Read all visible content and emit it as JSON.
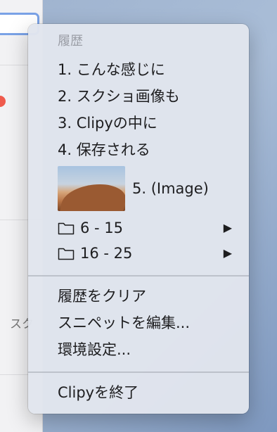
{
  "menu": {
    "header": "履歴",
    "history": [
      "1. こんな感じに",
      "2. スクショ画像も",
      "3. Clipyの中に",
      "4. 保存される"
    ],
    "image_item": {
      "label": "5. (Image)"
    },
    "folders": [
      {
        "label": "6 - 15",
        "arrow": "▶"
      },
      {
        "label": "16 - 25",
        "arrow": "▶"
      }
    ],
    "actions": [
      "履歴をクリア",
      "スニペットを編集...",
      "環境設定..."
    ],
    "quit": "Clipyを終了"
  },
  "background": {
    "partial_text": "スク"
  }
}
